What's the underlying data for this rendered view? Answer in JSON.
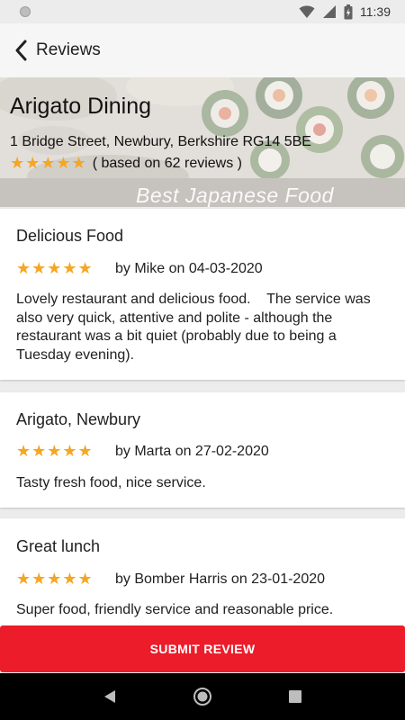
{
  "status_bar": {
    "time": "11:39",
    "icons": [
      "status-dot-icon",
      "wifi-icon",
      "signal-icon",
      "battery-icon"
    ]
  },
  "app_bar": {
    "title": "Reviews",
    "back_icon": "chevron-left-icon"
  },
  "restaurant": {
    "name": "Arigato Dining",
    "address": "1 Bridge Street, Newbury, Berkshire RG14 5BE",
    "stars": "★★★★★",
    "rating_text": "( based on 62 reviews )",
    "banner_text": "Best Japanese Food"
  },
  "reviews": [
    {
      "title": "Delicious Food",
      "stars": "★★★★★",
      "byline": "by Mike on 04-03-2020",
      "text": "Lovely restaurant and delicious food.    The service was also very quick, attentive and polite - although the restaurant was a bit quiet (probably due to being a Tuesday evening)."
    },
    {
      "title": "Arigato, Newbury",
      "stars": "★★★★★",
      "byline": "by Marta on 27-02-2020",
      "text": "Tasty fresh food, nice service."
    },
    {
      "title": "Great lunch",
      "stars": "★★★★★",
      "byline": "by Bomber Harris on 23-01-2020",
      "text": "Super food, friendly service and reasonable price."
    }
  ],
  "submit_button": {
    "label": "SUBMIT REVIEW"
  },
  "colors": {
    "accent": "#ec1c2a",
    "star": "#f5a623"
  },
  "nav_bar": {
    "icons": [
      "back-triangle-icon",
      "home-circle-icon",
      "recents-square-icon"
    ]
  }
}
